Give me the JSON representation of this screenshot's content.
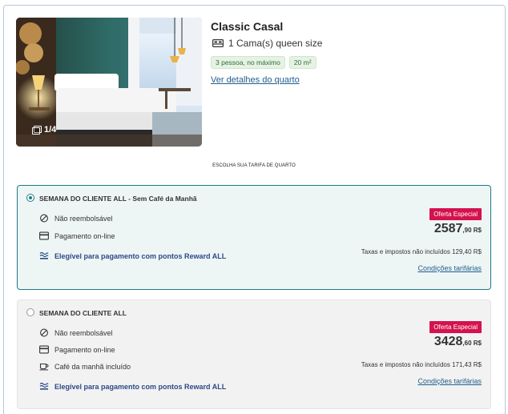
{
  "room": {
    "name": "Classic Casal",
    "bed": "1 Cama(s) queen size",
    "tags": [
      "3 pessoa, no máximo",
      "20 m²"
    ],
    "details_link": "Ver detalhes do quarto",
    "photo_counter": "1/4"
  },
  "choose_label": "ESCOLHA SUA TARIFA DE QUARTO",
  "rates": [
    {
      "title": "SEMANA DO CLIENTE ALL - Sem Café da Manhã",
      "selected": true,
      "features": [
        {
          "icon": "no-refund-icon",
          "label": "Não reembolsável"
        },
        {
          "icon": "credit-card-icon",
          "label": "Pagamento on-line"
        },
        {
          "icon": "reward-points-icon",
          "label": "Elegível para pagamento com pontos Reward ALL"
        }
      ],
      "badge": "Oferta Especial",
      "price_int": "2587",
      "price_dec": ",90 R$",
      "taxes": "Taxas e impostos não incluídos 129,40 R$",
      "conditions": "Condições tarifárias"
    },
    {
      "title": "SEMANA DO CLIENTE ALL",
      "selected": false,
      "features": [
        {
          "icon": "no-refund-icon",
          "label": "Não reembolsável"
        },
        {
          "icon": "credit-card-icon",
          "label": "Pagamento on-line"
        },
        {
          "icon": "breakfast-icon",
          "label": "Café da manhã incluído"
        },
        {
          "icon": "reward-points-icon",
          "label": "Elegível para pagamento com pontos Reward ALL"
        }
      ],
      "badge": "Oferta Especial",
      "price_int": "3428",
      "price_dec": ",60 R$",
      "taxes": "Taxas e impostos não incluídos 171,43 R$",
      "conditions": "Condições tarifárias"
    }
  ],
  "colors": {
    "accent": "#1d7a86",
    "badge": "#d4124d",
    "link": "#1f5f8b",
    "reward": "#2a4a87"
  }
}
